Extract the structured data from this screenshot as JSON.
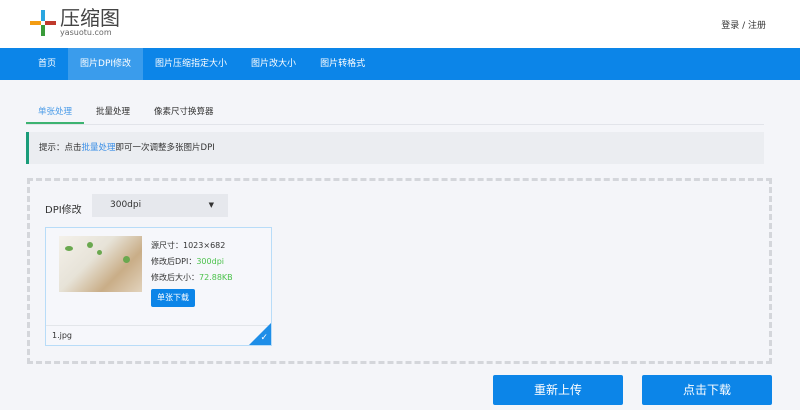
{
  "header": {
    "logo_cn": "压缩图",
    "logo_en": "yasuotu.com",
    "login": "登录",
    "separator": " / ",
    "register": "注册"
  },
  "nav": [
    "首页",
    "图片DPI修改",
    "图片压缩指定大小",
    "图片改大小",
    "图片转格式"
  ],
  "tabs": [
    "单张处理",
    "批量处理",
    "像素尺寸换算器"
  ],
  "tip": {
    "prefix": "提示：点击",
    "link": "批量处理",
    "suffix": "即可一次调整多张图片DPI"
  },
  "dpi": {
    "label": "DPI修改",
    "value": "300dpi"
  },
  "file": {
    "orig_label": "源尺寸：",
    "orig_value": "1023×682",
    "dpi_label": "修改后DPI：",
    "dpi_value": "300dpi",
    "size_label": "修改后大小：",
    "size_value": "72.88KB",
    "download": "单张下载",
    "name": "1.jpg"
  },
  "actions": {
    "reupload": "重新上传",
    "download": "点击下载"
  }
}
